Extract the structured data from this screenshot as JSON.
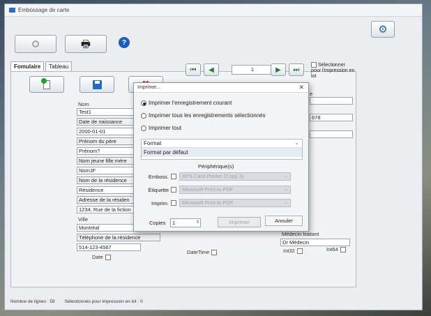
{
  "window": {
    "title": "Embossage de carte"
  },
  "tabs": [
    "Fomulaire",
    "Tableau"
  ],
  "navigator": {
    "record_number": "1"
  },
  "batch_selection": {
    "label": "Sélectionner pour l'impression en lot"
  },
  "form": {
    "nom": {
      "label": "Nom",
      "value": "Test1"
    },
    "date_naissance": {
      "label": "Date de naissance",
      "value": "2000-01-01"
    },
    "prenom_pere": {
      "label": "Prénom du père",
      "value": "Prénom?"
    },
    "nom_jeune_fille": {
      "label": "Nom jeune fille mère",
      "value": "NomJF"
    },
    "nom_residence": {
      "label": "Nom de la résidence",
      "value": "Résidence"
    },
    "adresse": {
      "label": "Adresse de la résiden",
      "value": "1234, Rue de la fiction"
    },
    "ville": {
      "label": "Ville",
      "value": "Montréal"
    },
    "telephone": {
      "label": "Téléphone de la résidence",
      "value": "514-123-4567"
    },
    "date_label": "Date",
    "datetime_label": "DateTime",
    "right_partial_label": "e",
    "right_partial_value": "678",
    "medecin": {
      "label": "Médecin traitant",
      "value": "Dr Médecin"
    },
    "int32_label": "Int32",
    "int64_label": "Int64"
  },
  "status_bar": {
    "row_count": "Nombre de lignes : 59",
    "selected_batch": "Sélectionnés pour impression en lot : 0"
  },
  "print_dialog": {
    "title": "Imprimer...",
    "options": [
      "Imprimer l'enregistrement courant",
      "Imprimer tous les enregistrements sélectionnés",
      "Imprimer tout"
    ],
    "selected_option": 0,
    "format_label": "Format",
    "format_value": "Format par défaut",
    "devices_header": "Périphérique(s)",
    "devices": [
      {
        "label": "Emboss.",
        "value": "XPS Card Printer (Copy 3)"
      },
      {
        "label": "Étiquette",
        "value": "Microsoft Print to PDF"
      },
      {
        "label": "Imprim.",
        "value": "Microsoft Print to PDF"
      }
    ],
    "copies_label": "Copies",
    "copies_value": "1",
    "print_button": "Imprimer",
    "cancel_button": "Annuler"
  }
}
